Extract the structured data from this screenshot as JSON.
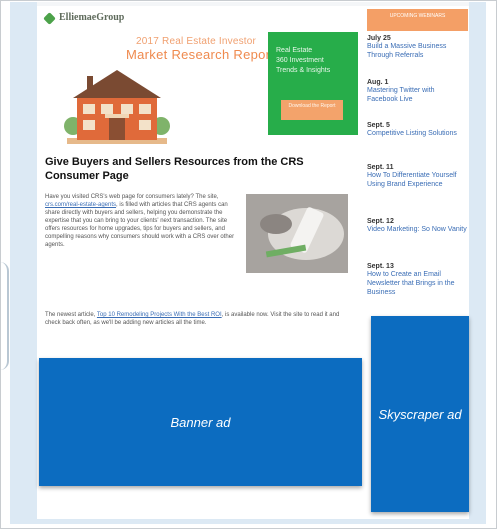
{
  "logo": {
    "text": "ElliemaeGroup"
  },
  "report": {
    "year_line": "2017 Real Estate Investor",
    "title": "Market Research Report"
  },
  "green_promo": {
    "lines": [
      "Real Estate",
      "360 Investment",
      "Trends & Insights"
    ],
    "button": "Download the Report"
  },
  "sidebar": {
    "header": "UPCOMING WEBINARS",
    "events": [
      {
        "date": "July 25",
        "title": "Build a Massive Business Through Referrals"
      },
      {
        "date": "Aug. 1",
        "title": "Mastering Twitter with Facebook Live"
      },
      {
        "date": "Sept. 5",
        "title": "Competitive Listing Solutions"
      },
      {
        "date": "Sept. 11",
        "title": "How To Differentiate Yourself Using Brand Experience"
      },
      {
        "date": "Sept. 12",
        "title": "Video Marketing: So Now Vanity"
      },
      {
        "date": "Sept. 13",
        "title": "How to Create an Email Newsletter that Brings in the Business"
      }
    ]
  },
  "article": {
    "headline": "Give Buyers and Sellers Resources from the CRS Consumer Page",
    "para1_before": "Have you visited CRS's web page for consumers lately? The site, ",
    "para1_link": "crs.com/real-estate-agents",
    "para1_after": ", is filled with articles that CRS agents can share directly with buyers and sellers, helping you demonstrate the expertise that you can bring to your clients' next transaction. The site offers resources for home upgrades, tips for buyers and sellers, and compelling reasons why consumers should work with a CRS over other agents.",
    "para2_before": "The newest article, ",
    "para2_link": "Top 10 Remodeling Projects With the Best ROI",
    "para2_after": ", is available now. Visit the site to read it and check back often, as we'll be adding new articles all the time."
  },
  "ads": {
    "banner": "Banner ad",
    "skyscraper": "Skyscraper ad"
  },
  "colors": {
    "ad_blue": "#0c6cc0",
    "green": "#27ad4a",
    "orange": "#f49f66",
    "link": "#3a6db5"
  }
}
